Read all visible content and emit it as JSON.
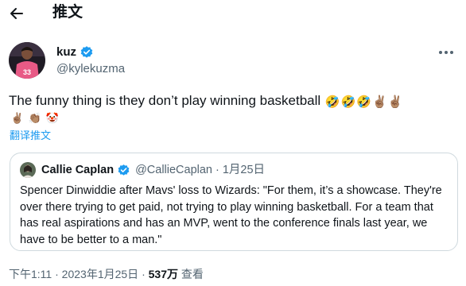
{
  "header": {
    "title": "推文",
    "back_icon": "arrow-left-icon"
  },
  "author": {
    "display_name": "kuz",
    "handle": "@kylekuzma",
    "avatar_jersey_number": "33",
    "verified_icon": "verified-badge-icon",
    "more_icon": "more-horizontal-icon"
  },
  "tweet": {
    "text": "The funny thing is they don’t play winning basketball",
    "emojis_line1": [
      "🤣",
      "🤣",
      "🤣",
      "✌🏽",
      "✌🏽"
    ],
    "emojis_line2": [
      "✌🏽",
      "👏🏽",
      "🤡"
    ]
  },
  "translate_label": "翻译推文",
  "quote": {
    "display_name": "Callie Caplan",
    "handle": "@CallieCaplan",
    "separator": "·",
    "date": "1月25日",
    "text": "Spencer Dinwiddie after Mavs' loss to Wizards: \"For them, it’s a showcase. They're over there trying to get paid, not trying to play winning basketball. For a team that has real aspirations and has an MVP, went to the conference finals last year, we have to be better to a man.\""
  },
  "meta": {
    "time": "下午1:11",
    "separator": " · ",
    "date": "2023年1月25日",
    "views_count": "537万",
    "views_label": "查看"
  },
  "colors": {
    "accent": "#1d9bf0",
    "secondary_text": "#536471",
    "border": "#cfd9de"
  }
}
